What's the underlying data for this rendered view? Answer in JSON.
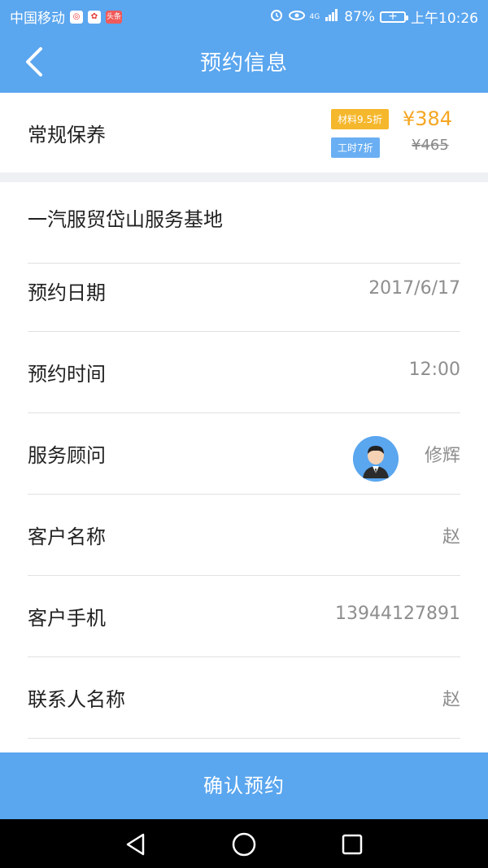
{
  "status_bar": {
    "carrier": "中国移动",
    "badge_text": "头条",
    "battery_percent": "87%",
    "time": "上午10:26",
    "network": "4G"
  },
  "header": {
    "title": "预约信息"
  },
  "service": {
    "name": "常规保养",
    "material_tag": "材料9.5折",
    "labor_tag": "工时7折",
    "price": "¥384",
    "original_price": "¥465"
  },
  "details": {
    "location": "一汽服贸岱山服务基地",
    "date_label": "预约日期",
    "date_value": "2017/6/17",
    "time_label": "预约时间",
    "time_value": "12:00",
    "advisor_label": "服务顾问",
    "advisor_name": "修辉",
    "customer_label": "客户名称",
    "customer_value": "赵",
    "phone_label": "客户手机",
    "phone_value": "13944127891",
    "contact_label": "联系人名称",
    "contact_value": "赵"
  },
  "actions": {
    "confirm_label": "确认预约"
  },
  "colors": {
    "primary": "#5aa6ef",
    "price_accent": "#f5a623",
    "tag_orange": "#f5b72b",
    "tag_blue": "#6aaff3"
  }
}
